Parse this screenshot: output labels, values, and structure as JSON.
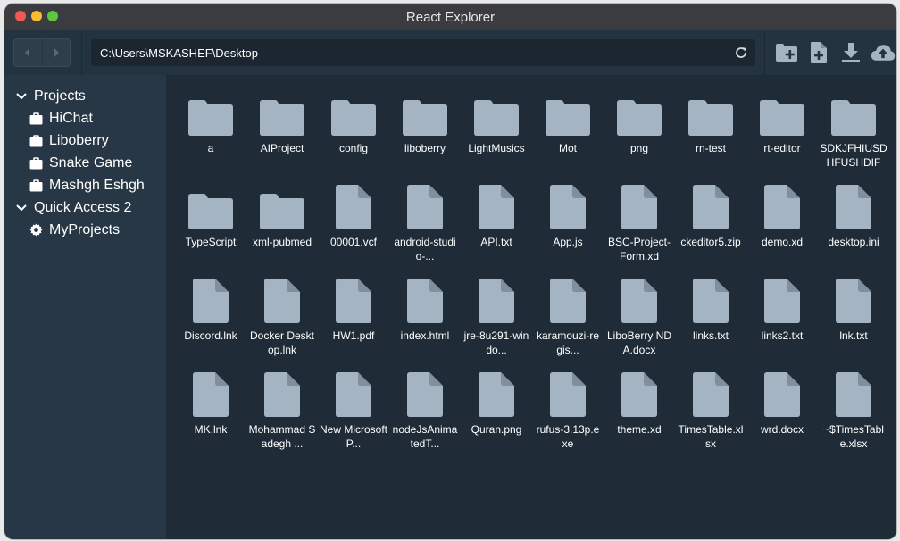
{
  "window": {
    "title": "React Explorer"
  },
  "colors": {
    "close": "#ee5a52",
    "minimize": "#f5bd2f",
    "maximize": "#5fc63f",
    "icon": "#a5b4c2"
  },
  "toolbar": {
    "path": "C:\\Users\\MSKASHEF\\Desktop",
    "actions": [
      "new-folder-icon",
      "new-file-icon",
      "download-icon",
      "cloud-upload-icon"
    ]
  },
  "sidebar": {
    "items": [
      {
        "type": "group",
        "label": "Projects",
        "icon": "chevron-down-icon"
      },
      {
        "type": "item",
        "label": "HiChat",
        "icon": "briefcase-icon"
      },
      {
        "type": "item",
        "label": "Liboberry",
        "icon": "briefcase-icon"
      },
      {
        "type": "item",
        "label": "Snake Game",
        "icon": "briefcase-icon"
      },
      {
        "type": "item",
        "label": "Mashgh Eshgh",
        "icon": "briefcase-icon"
      },
      {
        "type": "group",
        "label": "Quick Access 2",
        "icon": "chevron-down-icon"
      },
      {
        "type": "item",
        "label": "MyProjects",
        "icon": "gear-icon"
      }
    ]
  },
  "files": [
    {
      "name": "a",
      "kind": "folder"
    },
    {
      "name": "AIProject",
      "kind": "folder"
    },
    {
      "name": "config",
      "kind": "folder"
    },
    {
      "name": "liboberry",
      "kind": "folder"
    },
    {
      "name": "LightMusics",
      "kind": "folder"
    },
    {
      "name": "Mot",
      "kind": "folder"
    },
    {
      "name": "png",
      "kind": "folder"
    },
    {
      "name": "rn-test",
      "kind": "folder"
    },
    {
      "name": "rt-editor",
      "kind": "folder"
    },
    {
      "name": "SDKJFHIUSDHFUSHDIF",
      "kind": "folder"
    },
    {
      "name": "TypeScript",
      "kind": "folder"
    },
    {
      "name": "xml-pubmed",
      "kind": "folder"
    },
    {
      "name": "00001.vcf",
      "kind": "file"
    },
    {
      "name": "android-studio-...",
      "kind": "file"
    },
    {
      "name": "API.txt",
      "kind": "file"
    },
    {
      "name": "App.js",
      "kind": "file"
    },
    {
      "name": "BSC-Project-Form.xd",
      "kind": "file"
    },
    {
      "name": "ckeditor5.zip",
      "kind": "file"
    },
    {
      "name": "demo.xd",
      "kind": "file"
    },
    {
      "name": "desktop.ini",
      "kind": "file"
    },
    {
      "name": "Discord.lnk",
      "kind": "file"
    },
    {
      "name": "Docker Desktop.lnk",
      "kind": "file"
    },
    {
      "name": "HW1.pdf",
      "kind": "file"
    },
    {
      "name": "index.html",
      "kind": "file"
    },
    {
      "name": "jre-8u291-windo...",
      "kind": "file"
    },
    {
      "name": "karamouzi-regis...",
      "kind": "file"
    },
    {
      "name": "LiboBerry NDA.docx",
      "kind": "file"
    },
    {
      "name": "links.txt",
      "kind": "file"
    },
    {
      "name": "links2.txt",
      "kind": "file"
    },
    {
      "name": "lnk.txt",
      "kind": "file"
    },
    {
      "name": "MK.lnk",
      "kind": "file"
    },
    {
      "name": "Mohammad Sadegh ...",
      "kind": "file"
    },
    {
      "name": "New Microsoft P...",
      "kind": "file"
    },
    {
      "name": "nodeJsAnimatedT...",
      "kind": "file"
    },
    {
      "name": "Quran.png",
      "kind": "file"
    },
    {
      "name": "rufus-3.13p.exe",
      "kind": "file"
    },
    {
      "name": "theme.xd",
      "kind": "file"
    },
    {
      "name": "TimesTable.xlsx",
      "kind": "file"
    },
    {
      "name": "wrd.docx",
      "kind": "file"
    },
    {
      "name": "~$TimesTable.xlsx",
      "kind": "file"
    }
  ]
}
